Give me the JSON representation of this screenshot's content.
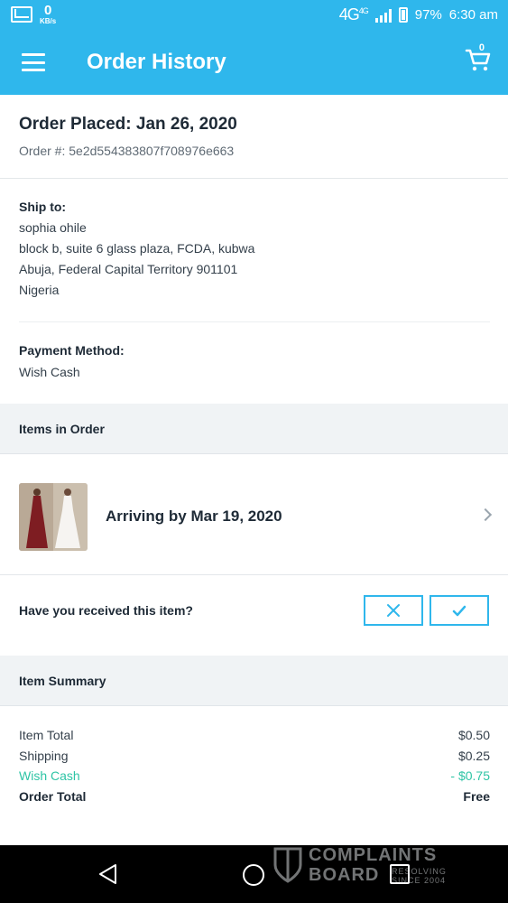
{
  "status_bar": {
    "speed_value": "0",
    "speed_unit": "KB/s",
    "network": "4G",
    "network_sup": "4G",
    "battery": "97%",
    "time": "6:30 am"
  },
  "app_bar": {
    "title": "Order History",
    "cart_count": "0"
  },
  "order": {
    "placed": "Order Placed: Jan 26, 2020",
    "number": "Order #: 5e2d554383807f708976e663"
  },
  "shipping": {
    "label": "Ship to:",
    "lines": [
      "sophia ohile",
      "block b, suite 6 glass plaza, FCDA, kubwa",
      "Abuja, Federal Capital Territory 901101",
      "Nigeria"
    ]
  },
  "payment": {
    "label": "Payment Method:",
    "value": "Wish Cash"
  },
  "items_section": {
    "header": "Items in Order",
    "arrival": "Arriving by Mar 19, 2020"
  },
  "received": {
    "question": "Have you received this item?"
  },
  "summary": {
    "header": "Item Summary",
    "rows": [
      {
        "label": "Item Total",
        "value": "$0.50"
      },
      {
        "label": "Shipping",
        "value": "$0.25"
      },
      {
        "label": "Wish Cash",
        "value": "- $0.75"
      },
      {
        "label": "Order Total",
        "value": "Free"
      }
    ]
  },
  "watermark": {
    "line1": "COMPLAINTS",
    "line2": "BOARD",
    "sub1": "RESOLVING",
    "sub2": "SINCE 2004"
  },
  "colors": {
    "primary": "#2fb7ec",
    "wish_cash": "#2ec4a5",
    "section_bg": "#f0f3f5"
  }
}
